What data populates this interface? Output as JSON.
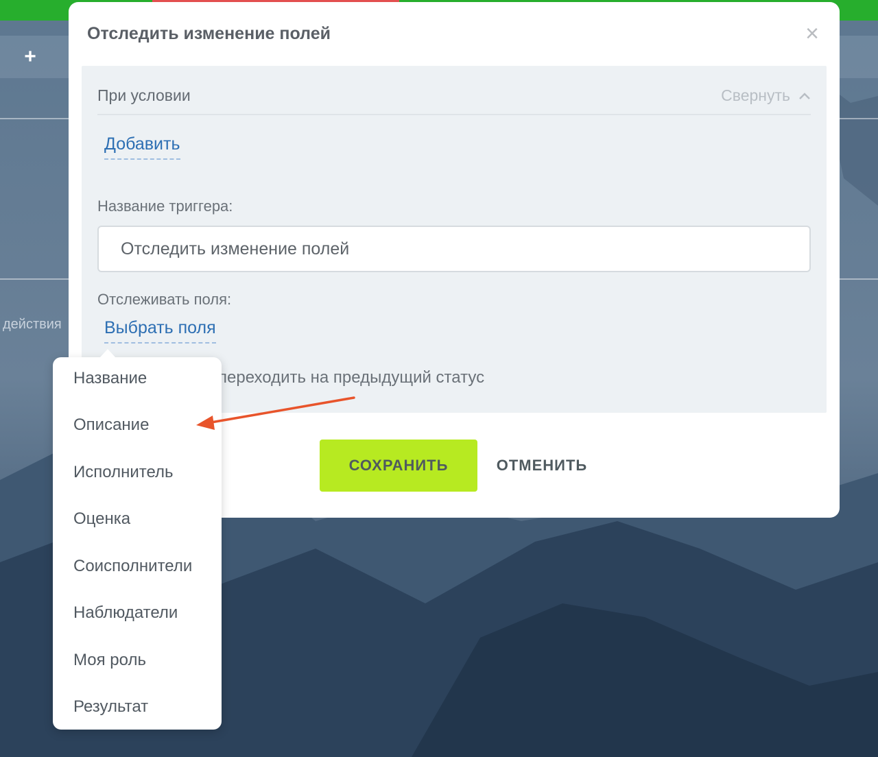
{
  "background": {
    "plus_label": "+",
    "actions_label": "действия",
    "colors": {
      "green": "#27ae2d",
      "red": "#e35050",
      "mountain": "#3c5673"
    }
  },
  "modal": {
    "title": "Отследить изменение полей",
    "close_icon": "close-icon",
    "condition": {
      "label": "При условии",
      "collapse_label": "Свернуть"
    },
    "add_link": "Добавить",
    "trigger_name_label": "Название триггера:",
    "trigger_name_value": "Отследить изменение полей",
    "track_fields_label": "Отслеживать поля:",
    "select_fields_link": "Выбрать поля",
    "status_option_text": "переходить на предыдущий статус",
    "save_button": "СОХРАНИТЬ",
    "cancel_button": "ОТМЕНИТЬ",
    "colors": {
      "save_button": "#b7ea21",
      "link": "#2d6fb3"
    }
  },
  "dropdown": {
    "items": [
      "Название",
      "Описание",
      "Исполнитель",
      "Оценка",
      "Соисполнители",
      "Наблюдатели",
      "Моя роль",
      "Результат"
    ]
  },
  "annotation": {
    "arrow_color": "#e8542b",
    "points_to": "Описание"
  }
}
